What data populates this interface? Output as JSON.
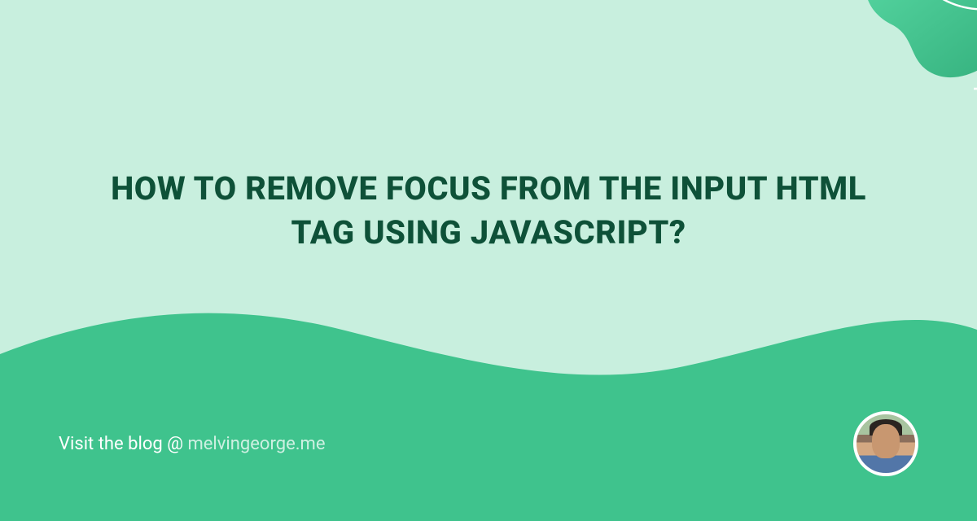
{
  "title": "HOW TO REMOVE FOCUS FROM THE INPUT HTML TAG USING JAVASCRIPT?",
  "footer": {
    "visit_prefix": "Visit the blog @ ",
    "url": "melvingeorge.me"
  },
  "colors": {
    "bg_light": "#c8efde",
    "accent": "#3fc38d",
    "text_dark": "#0e5138"
  }
}
